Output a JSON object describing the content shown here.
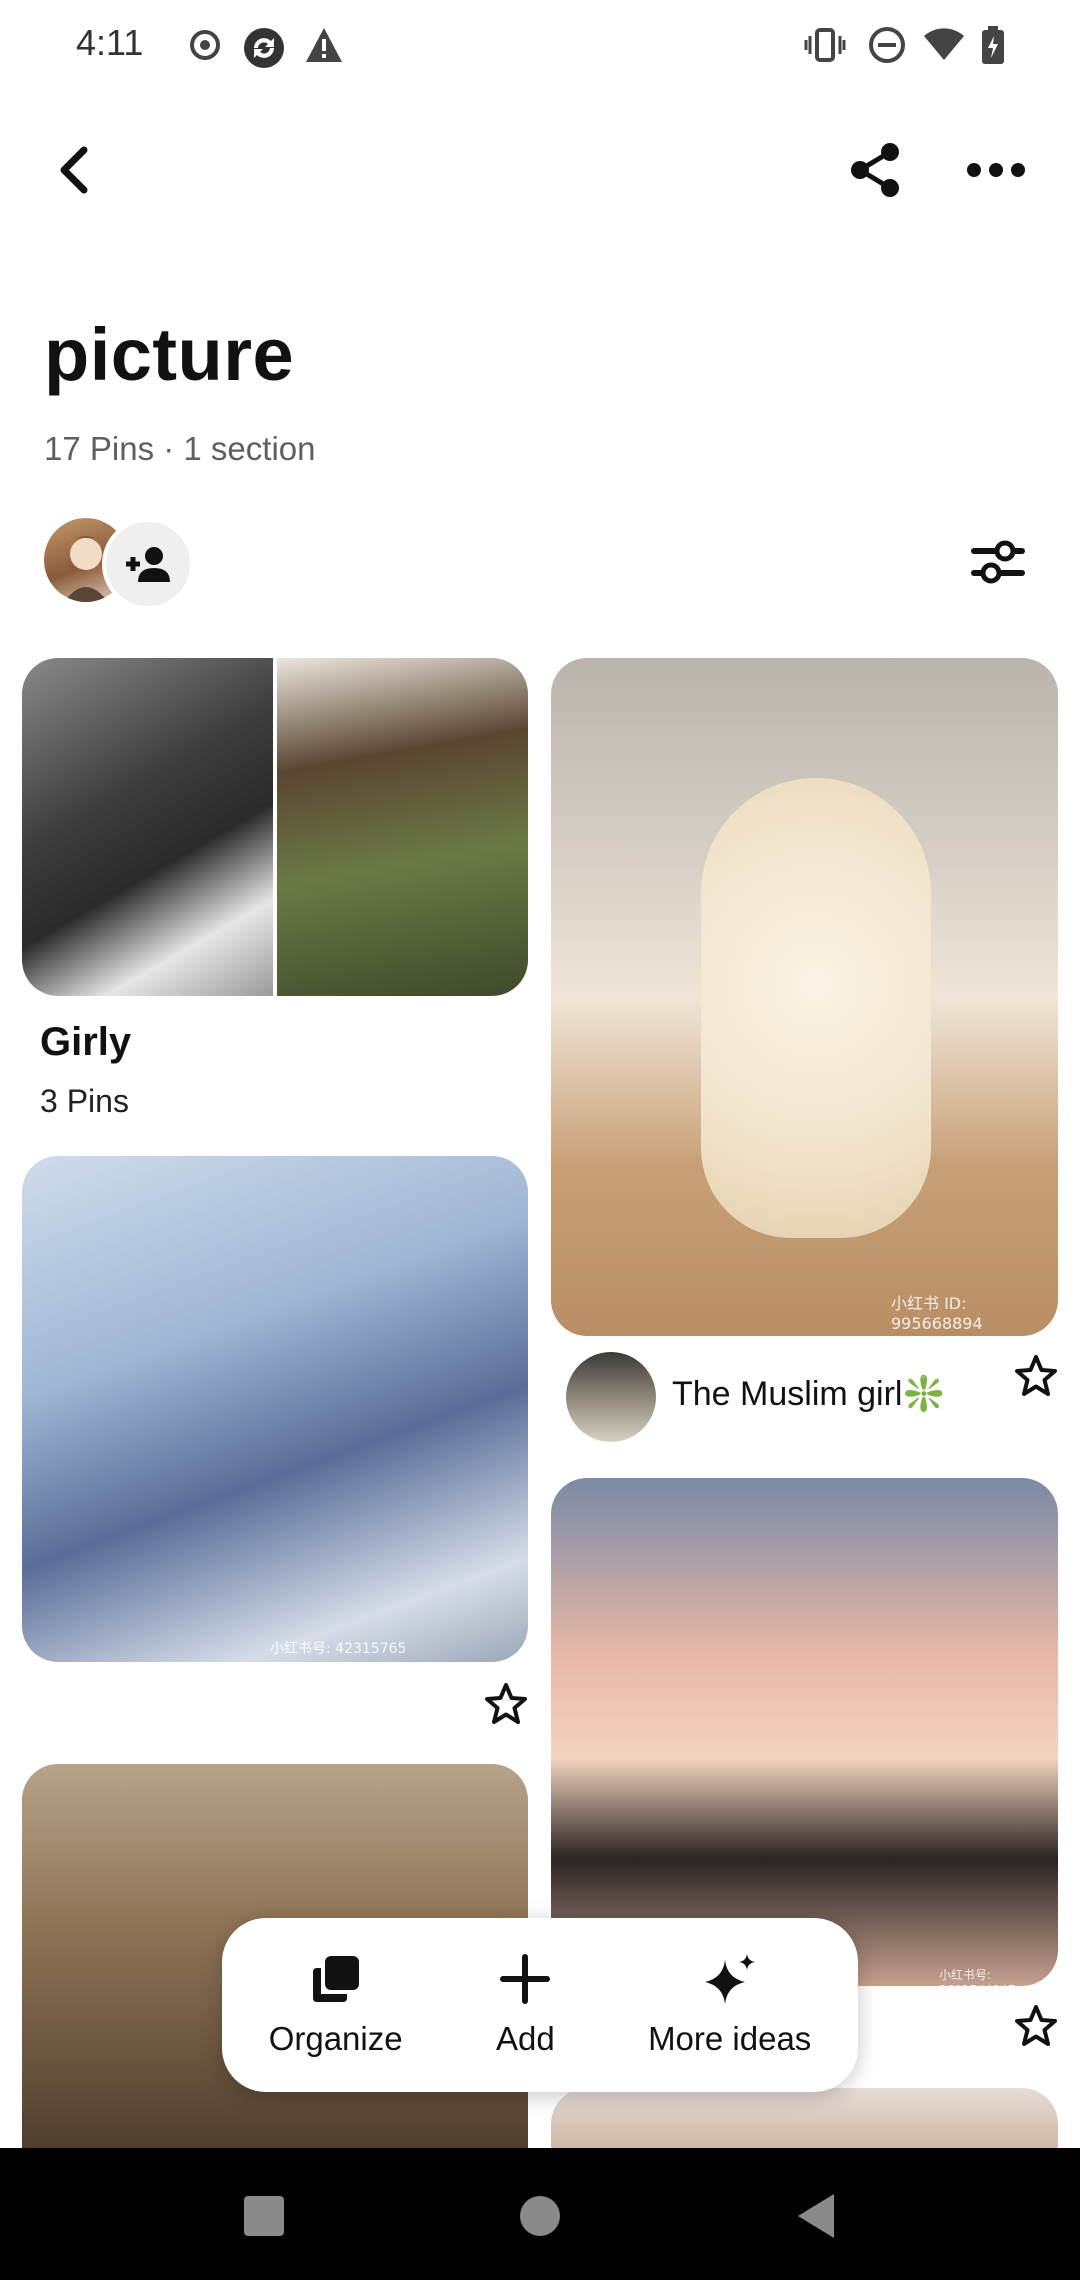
{
  "status_bar": {
    "time": "4:11",
    "left_icons": [
      "record-icon",
      "sync-icon",
      "warning-icon"
    ],
    "right_icons": [
      "vibrate-icon",
      "do-not-disturb-icon",
      "wifi-icon",
      "battery-charging-icon"
    ]
  },
  "top_bar": {
    "icons": [
      "back-arrow-icon",
      "share-icon",
      "more-options-icon"
    ]
  },
  "board": {
    "title": "picture",
    "subtitle": "17 Pins · 1 section",
    "icons": [
      "avatar",
      "add-collaborator-icon",
      "filter-icon"
    ]
  },
  "section": {
    "name": "Girly",
    "count": "3 Pins"
  },
  "pins": [
    {
      "id": "white-cat",
      "creator": "The Muslim girl❇️",
      "watermark": "小红书 ID: 995668894"
    },
    {
      "id": "girl-window",
      "watermark": "小红书号: 42315765"
    },
    {
      "id": "girl-with-cat",
      "watermark": "小红书号: 9691544947"
    },
    {
      "id": "girl-headphones"
    }
  ],
  "action_bar": {
    "organize_label": "Organize",
    "add_label": "Add",
    "more_ideas_label": "More ideas"
  },
  "nav_bar": {
    "icons": [
      "recents-icon",
      "home-icon",
      "back-icon"
    ]
  },
  "colors": {
    "text": "#111111",
    "subtext": "#5f5f5f",
    "nav_bg": "#000000"
  }
}
